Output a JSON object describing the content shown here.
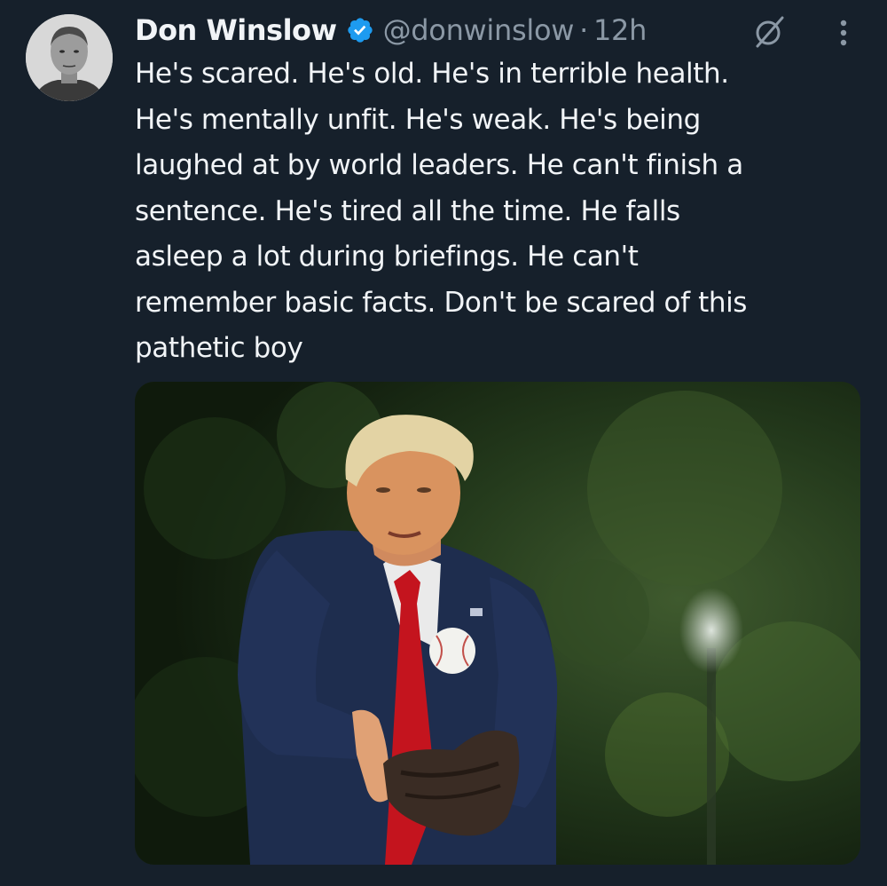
{
  "tweet": {
    "author": {
      "display_name": "Don Winslow",
      "handle": "@donwinslow",
      "verified_icon": "verified-badge-icon",
      "avatar": "author-avatar"
    },
    "separator": "·",
    "time": "12h",
    "actions": {
      "grok_icon": "grok-icon",
      "more_icon": "more-options-icon"
    },
    "text_lines": [
      "He's scared. He's old. He's in terrible health.",
      "He's mentally unfit. He's weak. He's being",
      "laughed at by world leaders. He can't finish a",
      "sentence. He's tired all the time. He falls",
      "asleep a lot during briefings. He can't",
      "remember basic facts. Don't be scared of this",
      "pathetic boy"
    ],
    "media": {
      "type": "photo"
    }
  },
  "colors": {
    "background": "#16202b",
    "text": "#f1f4f7",
    "secondary_text": "#8b98a5",
    "verified": "#1d9bf0"
  }
}
